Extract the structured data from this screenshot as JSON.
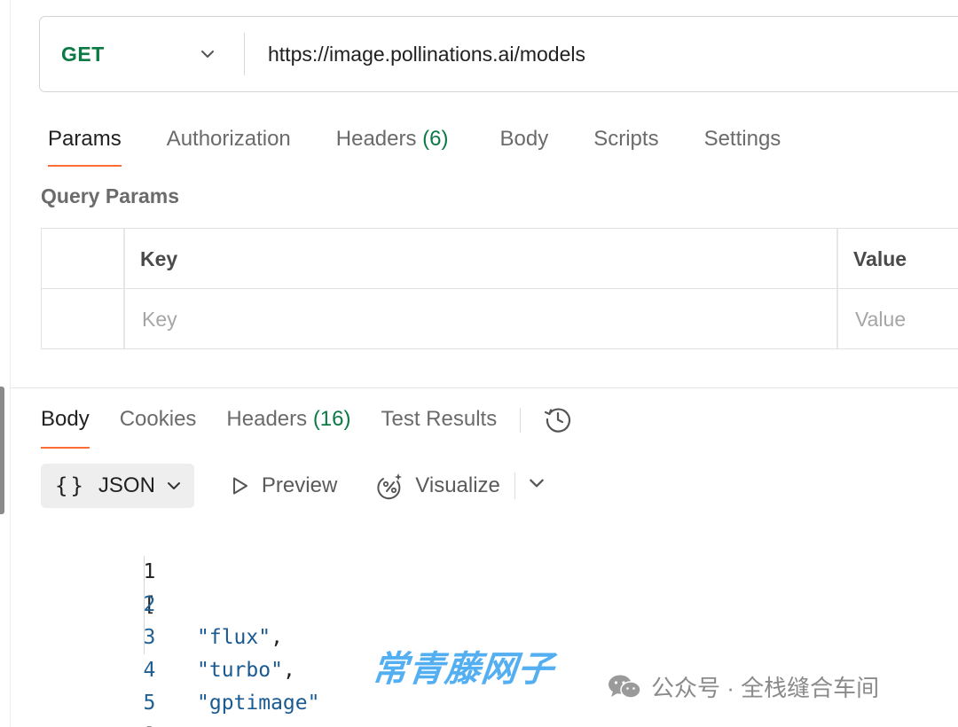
{
  "request": {
    "method": "GET",
    "url": "https://image.pollinations.ai/models"
  },
  "request_tabs": {
    "params": "Params",
    "authorization": "Authorization",
    "headers": "Headers",
    "headers_count": "(6)",
    "body": "Body",
    "scripts": "Scripts",
    "settings": "Settings"
  },
  "query_params": {
    "title": "Query Params",
    "key_header": "Key",
    "value_header": "Value",
    "key_placeholder": "Key",
    "value_placeholder": "Value"
  },
  "response_tabs": {
    "body": "Body",
    "cookies": "Cookies",
    "headers": "Headers",
    "headers_count": "(16)",
    "test_results": "Test Results"
  },
  "toolbar": {
    "format_braces": "{}",
    "format": "JSON",
    "preview": "Preview",
    "visualize": "Visualize"
  },
  "code": [
    {
      "num": "1",
      "text": "["
    },
    {
      "num": "2",
      "text": "\"flux\"",
      "suffix": ","
    },
    {
      "num": "3",
      "text": "\"turbo\"",
      "suffix": ","
    },
    {
      "num": "4",
      "text": "\"gptimage\"",
      "suffix": ""
    },
    {
      "num": "5",
      "text": "]"
    }
  ],
  "watermark": {
    "brand": "常青藤网子",
    "account": "公众号 · 全栈缝合车间"
  },
  "colors": {
    "method_green": "#0b7a45",
    "tab_accent": "#ff6c37",
    "json_string": "#1a5a92",
    "line_number": "#1f5f93",
    "watermark_blue": "#45a9f0"
  },
  "icons": [
    "chevron-down-icon",
    "history-icon",
    "play-icon",
    "visualize-icon",
    "wechat-icon"
  ]
}
